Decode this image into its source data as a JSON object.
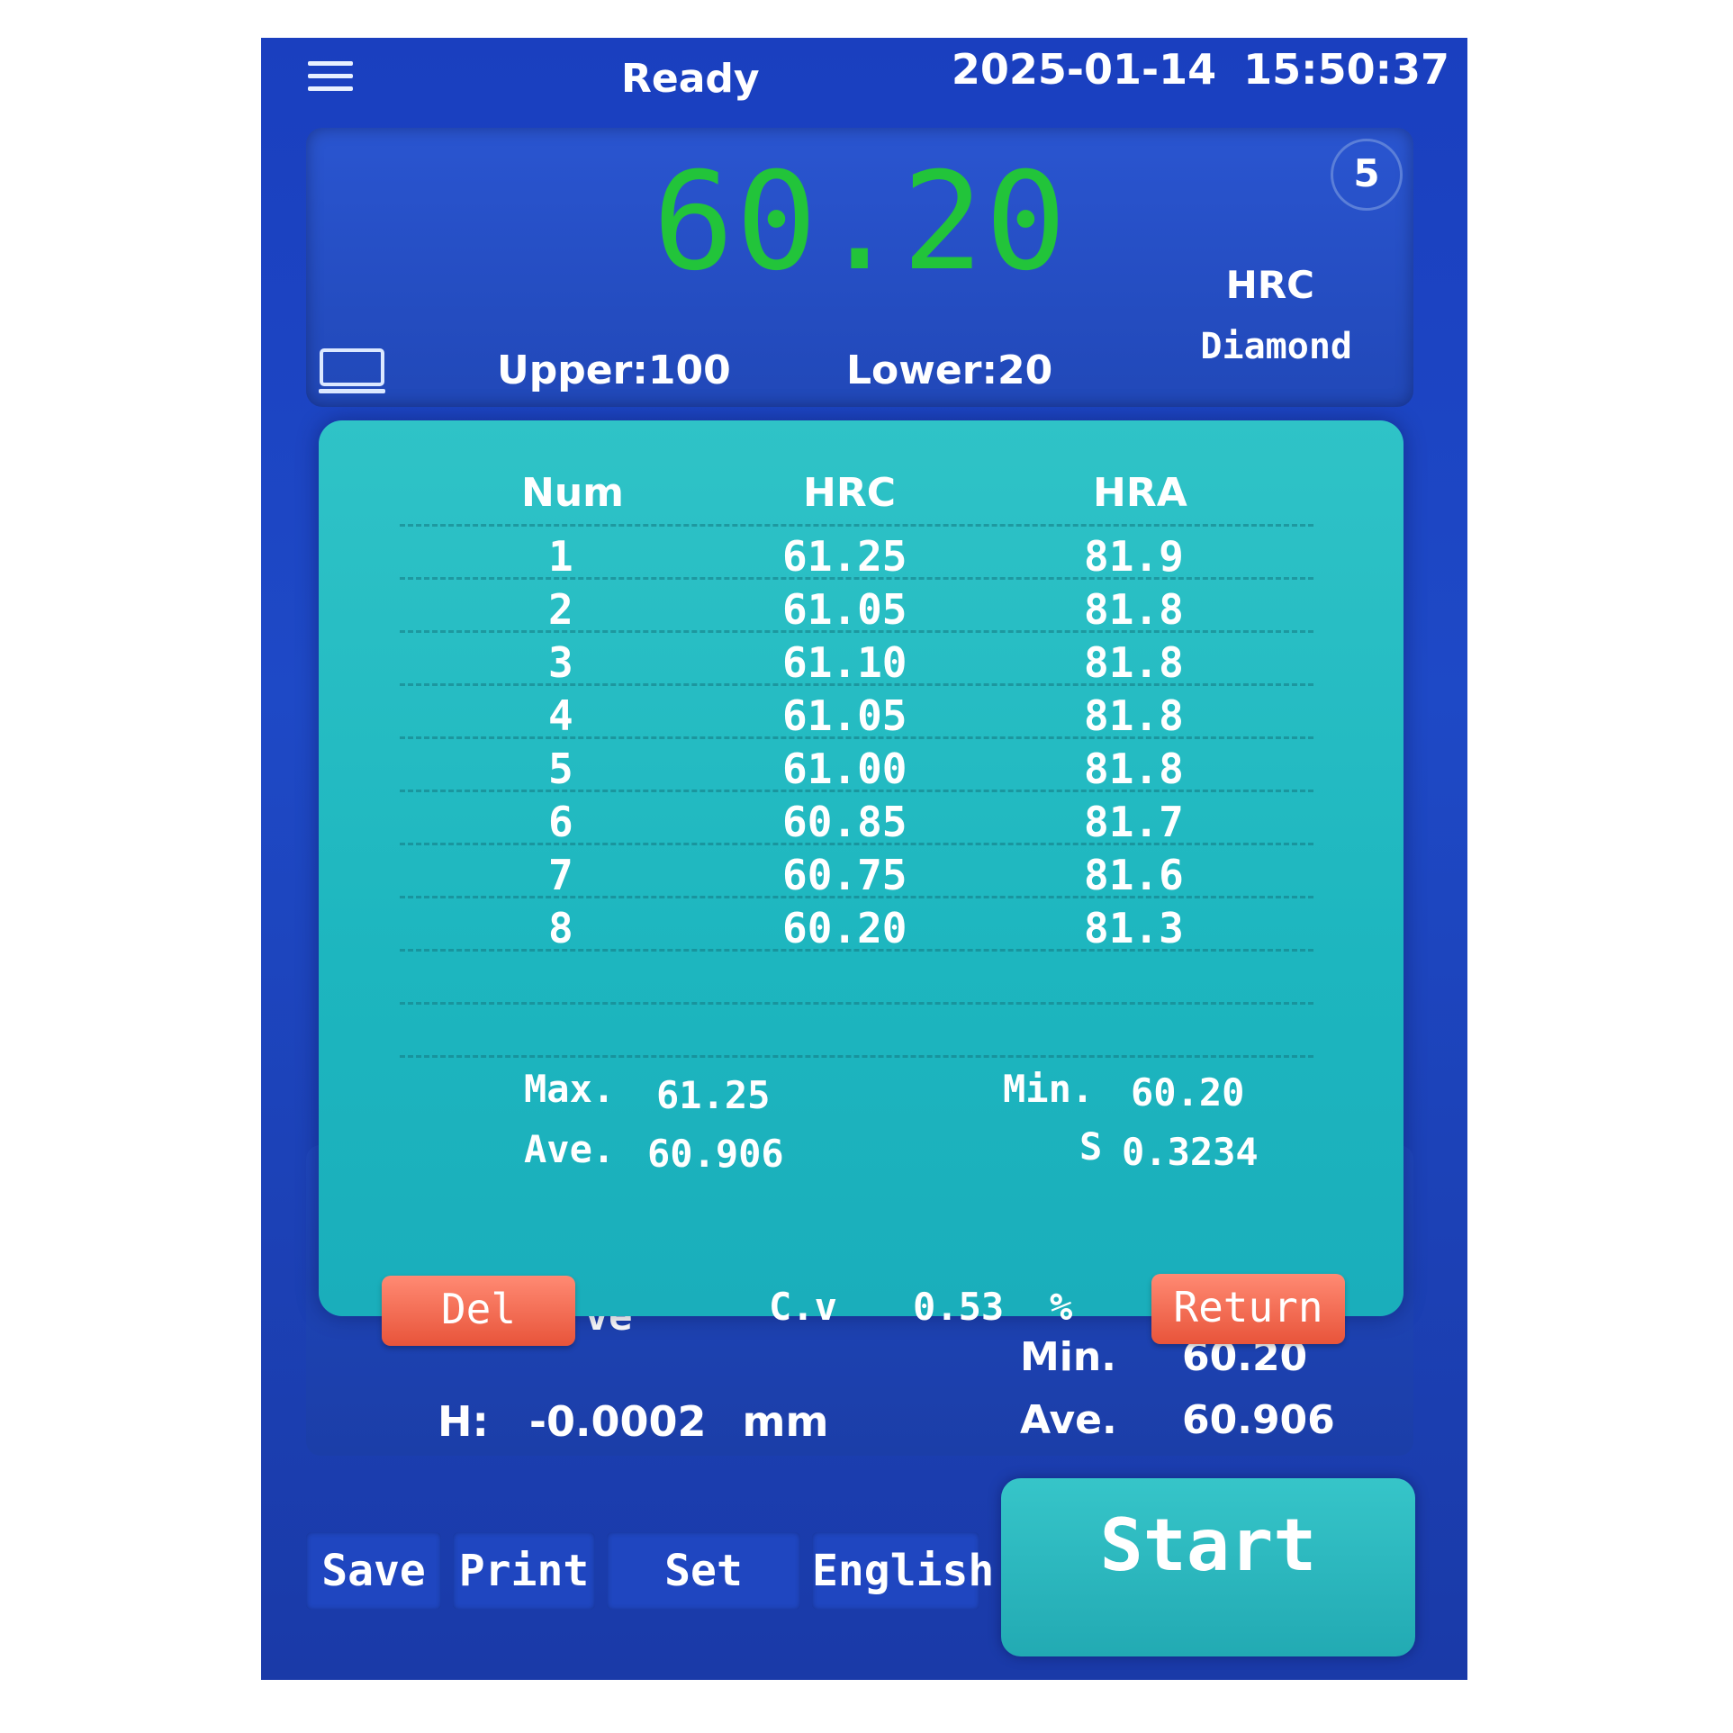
{
  "status_bar": {
    "status": "Ready",
    "date": "2025-01-14",
    "time": "15:50:37"
  },
  "reading": {
    "value": "60.20",
    "count": "5",
    "scale": "HRC",
    "indenter": "Diamond",
    "upper": "Upper:100",
    "lower": "Lower:20"
  },
  "results": {
    "headers": {
      "num": "Num",
      "hrc": "HRC",
      "hra": "HRA"
    },
    "rows": [
      {
        "num": "1",
        "hrc": "61.25",
        "hra": "81.9"
      },
      {
        "num": "2",
        "hrc": "61.05",
        "hra": "81.8"
      },
      {
        "num": "3",
        "hrc": "61.10",
        "hra": "81.8"
      },
      {
        "num": "4",
        "hrc": "61.05",
        "hra": "81.8"
      },
      {
        "num": "5",
        "hrc": "61.00",
        "hra": "81.8"
      },
      {
        "num": "6",
        "hrc": "60.85",
        "hra": "81.7"
      },
      {
        "num": "7",
        "hrc": "60.75",
        "hra": "81.6"
      },
      {
        "num": "8",
        "hrc": "60.20",
        "hra": "81.3"
      }
    ],
    "stats": {
      "max_label": "Max.",
      "max_value": "61.25",
      "min_label": "Min.",
      "min_value": "60.20",
      "ave_label": "Ave.",
      "ave_value": "60.906",
      "s_label": "S",
      "s_value": "0.3234",
      "cv_label": "C.v",
      "cv_value": "0.53",
      "cv_unit": "%"
    },
    "del_label": "Del",
    "return_label": "Return"
  },
  "measurement": {
    "curve_label": "Curve",
    "h_label": "H:",
    "h_value": "-0.0002",
    "h_unit": "mm",
    "min_label": "Min.",
    "min_value": "60.20",
    "ave_label": "Ave.",
    "ave_value": "60.906"
  },
  "toolbar": {
    "save": "Save",
    "print": "Print",
    "set": "Set",
    "language": "English",
    "start": "Start"
  },
  "colors": {
    "reading": "#22c43a",
    "accent_teal": "#2fc3c7",
    "button_red": "#e8543a",
    "background": "#1a3fbf"
  }
}
